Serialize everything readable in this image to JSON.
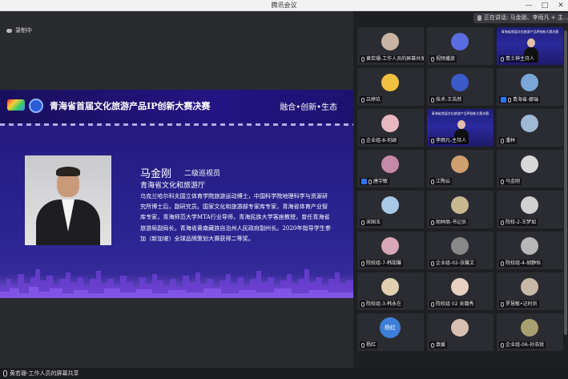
{
  "window": {
    "title": "腾讯会议",
    "controls": [
      "—",
      "□",
      "✕"
    ]
  },
  "main": {
    "recording_label": "录制中",
    "sharing_label": "黄若珊-工作人员的屏幕共享"
  },
  "slide": {
    "title": "青海省首届文化旅游产品IP创新大赛决赛",
    "slogan": "融合•创新•生态",
    "speaker_name": "马金刚",
    "speaker_role": "二级巡视员",
    "speaker_org": "青海省文化和旅游厅",
    "speaker_bio": "乌克兰哈尔科夫国立体育学院旅游运动博士，中国科学院地理科学与资源研究所博士后，副研究员。国家文化和旅游部专家库专家，青海省体育产业智库专家，青海师范大学MTA行业导师，青海民族大学客座教授，曾任青海省旅游局副局长，青海省黄南藏族自治州人民政府副州长。2020年指导学生参加（新加坡）全球品牌策划大赛获得二等奖。"
  },
  "sidebar": {
    "speaking_label": "正在讲话: 马金刚、李雨凡 + 主...",
    "participants": [
      {
        "name": "黄若珊-工作人员的屏幕共享",
        "avatar_color": "#c9b4a4",
        "mic": "on",
        "kind": "avatar"
      },
      {
        "name": "视频播放",
        "avatar_color": "#5a6de0",
        "mic": "on",
        "kind": "avatar"
      },
      {
        "name": "青土神主持人",
        "mic": "on",
        "kind": "video",
        "video_caption": "青海省首届文化旅游产品IP创新大赛决赛"
      },
      {
        "name": "吕婷玖",
        "avatar_color": "#f0c040",
        "mic": "on",
        "kind": "avatar"
      },
      {
        "name": "技术-王浩然",
        "avatar_color": "#3a5ac8",
        "mic": "on",
        "kind": "avatar"
      },
      {
        "name": "青海省-娜瑞",
        "avatar_color": "#7aa7d8",
        "mic": "on",
        "kind": "avatar",
        "badge": true
      },
      {
        "name": "企业组-8-何颖",
        "avatar_color": "#e8b8c0",
        "mic": "on",
        "kind": "avatar"
      },
      {
        "name": "李雨凡-主持人",
        "mic": "on",
        "kind": "video",
        "video_caption": "青海省首届文化旅游产品IP创新大赛决赛"
      },
      {
        "name": "潘林",
        "avatar_color": "#9fb8d6",
        "mic": "on",
        "kind": "avatar"
      },
      {
        "name": "唐宇敏",
        "avatar_color": "#c48aa8",
        "mic": "on",
        "kind": "avatar",
        "badge": true
      },
      {
        "name": "江陶云",
        "avatar_color": "#d0a070",
        "mic": "on",
        "kind": "avatar"
      },
      {
        "name": "马金刚",
        "avatar_color": "#d8d8d8",
        "mic": "on",
        "kind": "avatar"
      },
      {
        "name": "宋国玉",
        "avatar_color": "#a8c8e8",
        "mic": "on",
        "kind": "avatar"
      },
      {
        "name": "胡林丽-书记员",
        "avatar_color": "#c8b890",
        "mic": "on",
        "kind": "avatar"
      },
      {
        "name": "院校-2-王梦如",
        "avatar_color": "#d0d0d0",
        "mic": "on",
        "kind": "avatar"
      },
      {
        "name": "院校组-7-韩甜馨",
        "avatar_color": "#d8a8b8",
        "mic": "on",
        "kind": "avatar"
      },
      {
        "name": "企业组-02-张馨文",
        "avatar_color": "#888888",
        "mic": "on",
        "kind": "avatar"
      },
      {
        "name": "院校组-4-胡静怡",
        "avatar_color": "#b8b8b8",
        "mic": "on",
        "kind": "avatar"
      },
      {
        "name": "院校组-3-韩永在",
        "avatar_color": "#e0d0b0",
        "mic": "on",
        "kind": "avatar"
      },
      {
        "name": "院校组 02 吴璐秀",
        "avatar_color": "#e8d0c0",
        "mic": "on",
        "kind": "avatar"
      },
      {
        "name": "罗慧敏•记时员",
        "avatar_color": "#c8b8a8",
        "mic": "on",
        "kind": "avatar"
      },
      {
        "name": "杨红",
        "avatar_text": "杨红",
        "avatar_color": "#3d7fd8",
        "mic": "on",
        "kind": "avatar"
      },
      {
        "name": "袁媛",
        "avatar_color": "#d8c0b0",
        "mic": "on",
        "kind": "avatar"
      },
      {
        "name": "企业组-06-孙浩锐",
        "avatar_color": "#a8a070",
        "mic": "on",
        "kind": "avatar"
      }
    ]
  }
}
